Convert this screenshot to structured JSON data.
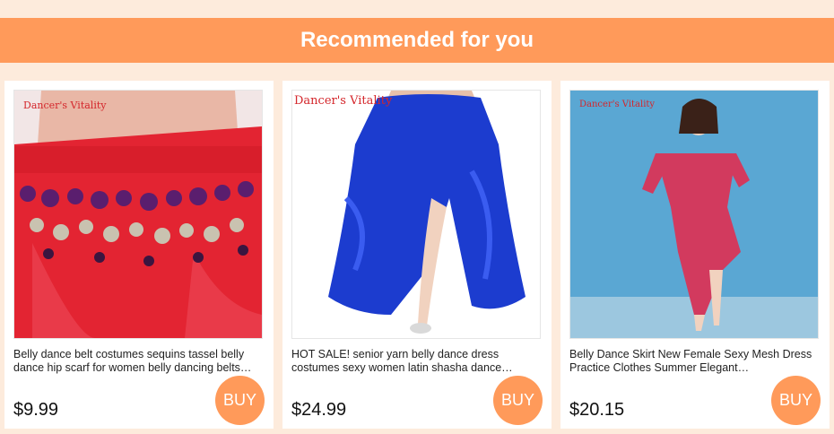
{
  "header": {
    "title": "Recommended for you"
  },
  "products": [
    {
      "brand": "Dancer's Vitality",
      "title": "Belly dance belt costumes sequins tassel belly dance hip scarf for women belly dancing belts…",
      "price": "$9.99",
      "buy_label": "BUY"
    },
    {
      "brand": "Dancer's Vitality",
      "title": "HOT SALE! senior yarn belly dance dress costumes sexy women latin shasha dance…",
      "price": "$24.99",
      "buy_label": "BUY"
    },
    {
      "brand": "Dancer's Vitality",
      "title": "Belly Dance Skirt New Female Sexy Mesh Dress Practice Clothes Summer Elegant…",
      "price": "$20.15",
      "buy_label": "BUY"
    }
  ],
  "colors": {
    "accent": "#ff9a5a",
    "page_background": "#fdebdc",
    "brand_text": "#d4262b"
  }
}
